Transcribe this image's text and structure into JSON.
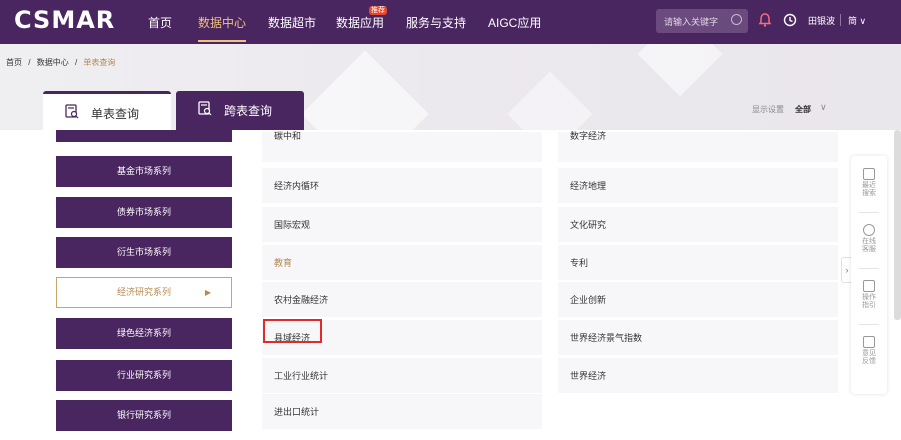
{
  "header": {
    "logo": "CSMAR",
    "nav": [
      "首页",
      "数据中心",
      "数据超市",
      "数据应用",
      "服务与支持",
      "AIGC应用"
    ],
    "hot_badge": "推荐",
    "search_placeholder": "请输入关键字",
    "user": "田银波",
    "lang": "简 ∨"
  },
  "breadcrumb": {
    "home": "首页",
    "sep": "/",
    "center": "数据中心",
    "current": "单表查询"
  },
  "tabs": [
    "单表查询",
    "跨表查询"
  ],
  "display": {
    "settings": "显示设置",
    "all": "全部",
    "chevron": "∨"
  },
  "sidebar": {
    "items": [
      "基金市场系列",
      "债券市场系列",
      "衍生市场系列",
      "经济研究系列",
      "绿色经济系列",
      "行业研究系列",
      "银行研究系列"
    ],
    "active": "经济研究系列",
    "arrow": "▶"
  },
  "grid": {
    "left": [
      "碳中和",
      "经济内循环",
      "国际宏观",
      "教育",
      "农村金融经济",
      "县域经济",
      "工业行业统计",
      "进出口统计"
    ],
    "right": [
      "数字经济",
      "经济地理",
      "文化研究",
      "专利",
      "企业创新",
      "世界经济景气指数",
      "世界经济"
    ],
    "highlighted": "县域经济",
    "muted": "教育"
  },
  "side_panel": {
    "items": [
      {
        "line1": "最近",
        "line2": "搜索"
      },
      {
        "line1": "在线",
        "line2": "客服"
      },
      {
        "line1": "操作",
        "line2": "指引"
      },
      {
        "line1": "意见",
        "line2": "反馈"
      }
    ],
    "collapse": "›"
  },
  "colors": {
    "primary": "#4a2660",
    "accent": "#f1c27d",
    "gold": "#b58a4f",
    "highlight": "#e02b2b"
  }
}
